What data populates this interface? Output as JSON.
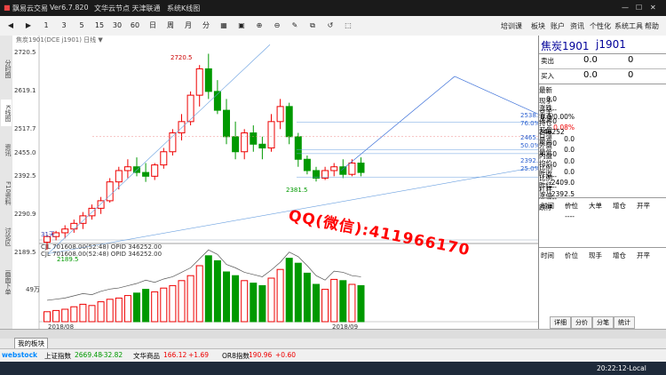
{
  "title_bar": {
    "app": "飘易云交易",
    "version": "Ver6.7.820",
    "ad": "文华云节点 天津联通",
    "mode": "系统K线图"
  },
  "toolbar": {
    "buttons": [
      "◀",
      "▶",
      "1",
      "3",
      "5",
      "15",
      "30",
      "60",
      "日",
      "周",
      "月",
      "分",
      "▦",
      "▣",
      "⊕",
      "⊖",
      "✎",
      "⧉",
      "↺",
      "⬚"
    ],
    "menu": [
      "培训课",
      "板块",
      "账户",
      "资讯",
      "个性化",
      "系统工具",
      "帮助"
    ]
  },
  "left_tabs": [
    "分时图",
    "K线图",
    "资讯",
    "F10资料",
    "讨论区",
    "画面下单"
  ],
  "chart_info": "焦炭1901(DCE j1901) 日线 ▼",
  "price_axis": [
    "2720.5",
    "2619.1",
    "2517.7",
    "2455.0",
    "2392.5",
    "2290.9",
    "2189.5"
  ],
  "annotations": {
    "high": "2720.5",
    "low": "2189.5",
    "mid_low": "2381.5",
    "fib": [
      "2538.0",
      "76.0%",
      "2465.2",
      "50.0%",
      "2392.9",
      "25.0%"
    ],
    "period": "31天"
  },
  "volume_info": {
    "label": "CJL",
    "vol": "701608.00(52:48)",
    "opid_label": "OPID",
    "opid": "346252.00",
    "line2": "701608.00(52:48)",
    "opid2": "346252.00",
    "axis_label": "49万"
  },
  "date_axis": [
    "2018/08",
    "2018/09"
  ],
  "watermark": "QQ(微信):411966170",
  "chart_data": {
    "type": "candlestick",
    "ohlc": [
      [
        2220,
        2240,
        2200,
        2235
      ],
      [
        2235,
        2250,
        2225,
        2245
      ],
      [
        2245,
        2265,
        2230,
        2255
      ],
      [
        2255,
        2280,
        2245,
        2270
      ],
      [
        2270,
        2300,
        2255,
        2290
      ],
      [
        2290,
        2320,
        2280,
        2310
      ],
      [
        2310,
        2340,
        2295,
        2330
      ],
      [
        2330,
        2390,
        2325,
        2380
      ],
      [
        2380,
        2420,
        2360,
        2410
      ],
      [
        2410,
        2440,
        2390,
        2420
      ],
      [
        2420,
        2445,
        2395,
        2405
      ],
      [
        2405,
        2430,
        2380,
        2395
      ],
      [
        2395,
        2430,
        2385,
        2425
      ],
      [
        2425,
        2470,
        2415,
        2460
      ],
      [
        2460,
        2520,
        2450,
        2510
      ],
      [
        2510,
        2560,
        2490,
        2540
      ],
      [
        2540,
        2620,
        2530,
        2610
      ],
      [
        2610,
        2690,
        2580,
        2680
      ],
      [
        2680,
        2720,
        2600,
        2620
      ],
      [
        2620,
        2650,
        2560,
        2570
      ],
      [
        2570,
        2600,
        2480,
        2500
      ],
      [
        2500,
        2540,
        2440,
        2460
      ],
      [
        2460,
        2520,
        2440,
        2510
      ],
      [
        2510,
        2530,
        2460,
        2480
      ],
      [
        2480,
        2500,
        2440,
        2470
      ],
      [
        2470,
        2560,
        2460,
        2540
      ],
      [
        2540,
        2600,
        2520,
        2580
      ],
      [
        2580,
        2590,
        2480,
        2500
      ],
      [
        2500,
        2510,
        2420,
        2440
      ],
      [
        2440,
        2450,
        2400,
        2410
      ],
      [
        2410,
        2420,
        2381,
        2390
      ],
      [
        2390,
        2420,
        2385,
        2410
      ],
      [
        2410,
        2430,
        2395,
        2420
      ],
      [
        2420,
        2440,
        2390,
        2400
      ],
      [
        2400,
        2440,
        2395,
        2430
      ],
      [
        2430,
        2445,
        2395,
        2405
      ]
    ],
    "volume": [
      8,
      9,
      10,
      12,
      14,
      13,
      16,
      18,
      19,
      21,
      23,
      26,
      24,
      27,
      29,
      33,
      37,
      45,
      53,
      49,
      40,
      37,
      33,
      31,
      29,
      35,
      42,
      51,
      47,
      39,
      30,
      26,
      34,
      33,
      30,
      29
    ]
  },
  "panel": {
    "title": "焦炭1901",
    "code": "j1901",
    "sell": {
      "label": "卖出",
      "price": "0.0",
      "qty": "0"
    },
    "buy": {
      "label": "买入",
      "price": "0.0",
      "qty": "0"
    },
    "stats": [
      [
        "最新",
        "0.0",
        "涨跌",
        "0.0/0.00%"
      ],
      [
        "现手",
        "----",
        "涨速",
        "0.08%"
      ],
      [
        "总手",
        "0",
        "开盘",
        "0.0"
      ],
      [
        "持仓",
        "346252",
        "最高",
        "0.0"
      ],
      [
        "日增",
        "0",
        "最低",
        "0.0"
      ],
      [
        "外盘",
        "0",
        "均价",
        "0.0"
      ],
      [
        "内盘",
        "0",
        "昨收",
        "2409.0"
      ],
      [
        "比例",
        "----",
        "昨结",
        "2392.5"
      ],
      [
        "比例",
        "----",
        "涨停",
        "----"
      ],
      [
        "杠杆",
        "----",
        "跌停",
        "----"
      ]
    ],
    "trade_headers1": [
      "时间",
      "价位",
      "大单",
      "增仓",
      "开平"
    ],
    "trade_headers2": [
      "时间",
      "价位",
      "现手",
      "增仓",
      "开平"
    ],
    "bottom_tabs": [
      "详细",
      "分价",
      "分笔",
      "统计"
    ]
  },
  "bottom": {
    "board_tab": "我的板块",
    "ticker": [
      {
        "name": "上证指数",
        "value": "2669.48",
        "change": "-32.82"
      },
      {
        "name": "文华商品",
        "value": "166.12",
        "change": "+1.69"
      },
      {
        "name": "OR8指数",
        "value": "190.96",
        "change": "+0.60"
      }
    ],
    "logo": "webstock",
    "clock": "20:22:12-Local"
  }
}
